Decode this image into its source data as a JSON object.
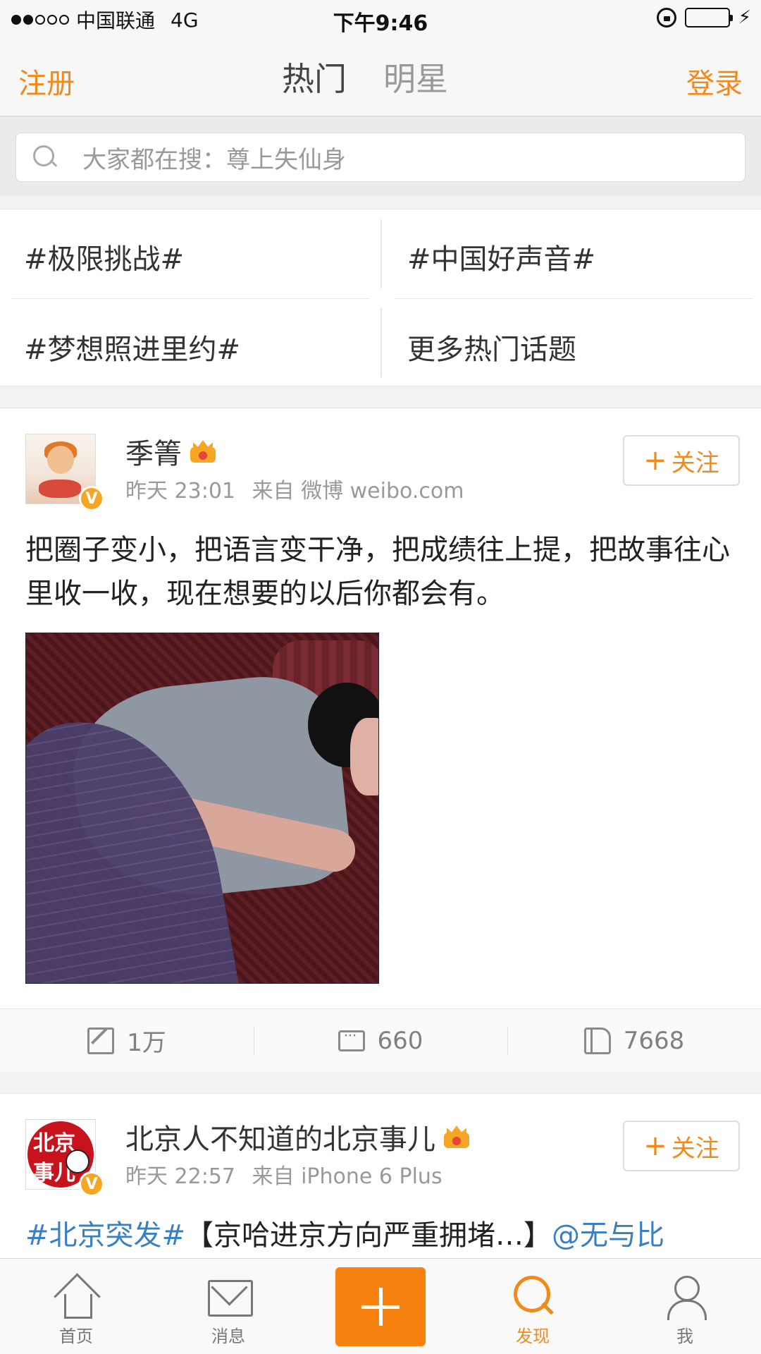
{
  "status_bar": {
    "carrier": "中国联通",
    "network": "4G",
    "time": "下午9:46"
  },
  "header": {
    "left_link": "注册",
    "right_link": "登录",
    "tabs": [
      {
        "label": "热门",
        "active": true
      },
      {
        "label": "明星",
        "active": false
      }
    ]
  },
  "search": {
    "placeholder": "大家都在搜：尊上失仙身"
  },
  "topics": [
    "#极限挑战#",
    "#中国好声音#",
    "#梦想照进里约#",
    "更多热门话题"
  ],
  "posts": [
    {
      "username": "季箐",
      "time": "昨天 23:01",
      "source": "来自 微博 weibo.com",
      "follow_label": "关注",
      "verified_badge": "V",
      "text": "把圈子变小，把语言变干净，把成绩往上提，把故事往心里收一收，现在想要的以后你都会有。",
      "reposts": "1万",
      "comments": "660",
      "likes": "7668"
    },
    {
      "username": "北京人不知道的北京事儿",
      "time": "昨天 22:57",
      "source": "来自 iPhone 6 Plus",
      "follow_label": "关注",
      "verified_badge": "V",
      "avatar_logo_line1": "北京",
      "avatar_logo_line2": "事儿",
      "text_hashtag": "#北京突发#",
      "text_body": "【京哈进京方向严重拥堵…】",
      "text_mention": "@无与比"
    }
  ],
  "tabbar": [
    {
      "label": "首页",
      "icon": "home-icon"
    },
    {
      "label": "消息",
      "icon": "mail-icon"
    },
    {
      "label": "",
      "icon": "plus-icon"
    },
    {
      "label": "发现",
      "icon": "search-icon",
      "active": true
    },
    {
      "label": "我",
      "icon": "person-icon"
    }
  ],
  "colors": {
    "accent": "#f08a1c",
    "link": "#3a7fc1",
    "verified": "#f5a623"
  }
}
